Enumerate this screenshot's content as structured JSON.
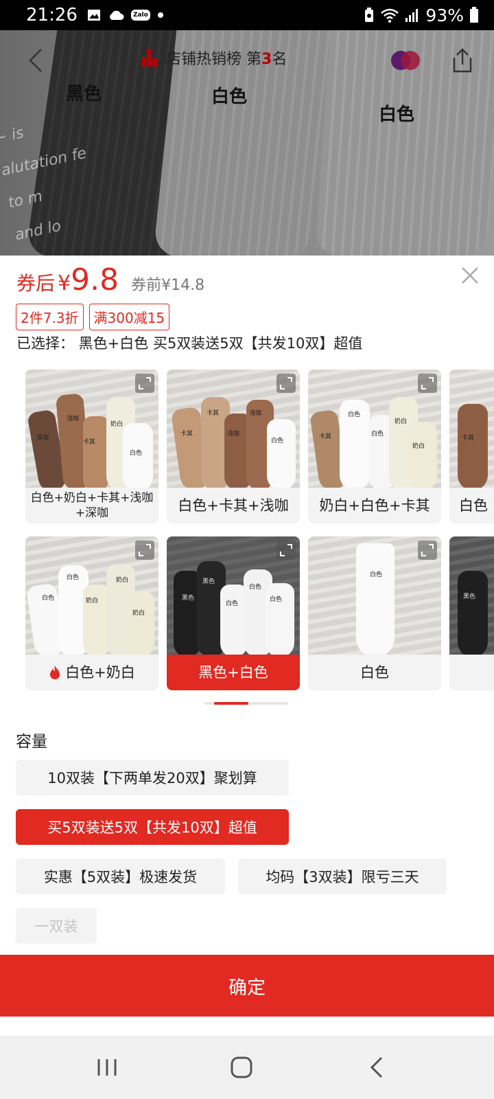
{
  "status_bar": {
    "time": "21:26",
    "zalo": "Zalo",
    "battery": "93%"
  },
  "top_bar": {
    "rank_prefix": "店铺热销榜 第",
    "rank_num": "3",
    "rank_suffix": "名"
  },
  "background_image": {
    "label_1": "黑色",
    "label_2": "白色",
    "label_3": "白色",
    "script_lines": [
      "~ is",
      "alutation fe",
      "to m",
      "and lo"
    ]
  },
  "price": {
    "after_label": "券后",
    "currency": "¥",
    "value": "9.8",
    "before": "券前¥14.8"
  },
  "tags": [
    "2件7.3折",
    "满300减15"
  ],
  "selected_text": "已选择： 黑色+白色 买5双装送5双【共发10双】超值",
  "color_options": [
    {
      "label": "白色+奶白+卡其+浅咖+深咖",
      "active": false
    },
    {
      "label": "白色+卡其+浅咖",
      "active": false
    },
    {
      "label": "奶白+白色+卡其",
      "active": false
    },
    {
      "label": "白色",
      "active": false
    },
    {
      "label": "白色+奶白",
      "active": false,
      "hot": true
    },
    {
      "label": "黑色+白色",
      "active": true
    },
    {
      "label": "白色",
      "active": false
    },
    {
      "label": "",
      "active": false
    }
  ],
  "sock_labels": {
    "c1": [
      "深咖",
      "浅咖",
      "卡其",
      "奶白",
      "白色"
    ],
    "c2": [
      "卡其",
      "卡其",
      "浅咖",
      "浅咖",
      "白色"
    ],
    "c3": [
      "卡其",
      "白色",
      "白色",
      "奶白",
      "奶白"
    ],
    "c4": [
      "卡其"
    ],
    "c5": [
      "白色",
      "白色",
      "奶白",
      "奶白",
      "奶白"
    ],
    "c6": [
      "黑色",
      "黑色",
      "白色",
      "白色",
      "白色"
    ],
    "c7": [
      "白色"
    ],
    "c8": [
      "黑色"
    ]
  },
  "capacity": {
    "title": "容量",
    "options": [
      {
        "label": "10双装【下两单发20双】聚划算",
        "state": "normal"
      },
      {
        "label": "买5双装送5双【共发10双】超值",
        "state": "active"
      },
      {
        "label": "实惠【5双装】极速发货",
        "state": "normal"
      },
      {
        "label": "均码【3双装】限亏三天",
        "state": "normal"
      },
      {
        "label": "一双装",
        "state": "disabled"
      }
    ]
  },
  "confirm_label": "确定",
  "colors": {
    "accent": "#e02a22",
    "chip_bg": "#f3f3f3"
  }
}
